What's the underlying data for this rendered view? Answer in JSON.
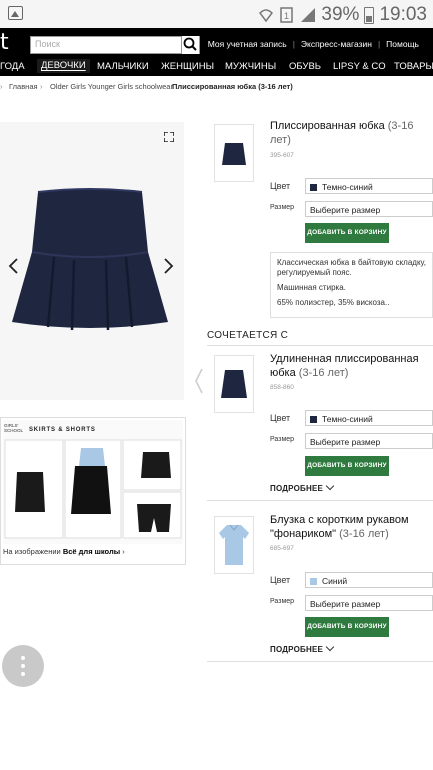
{
  "status_bar": {
    "battery": "39%",
    "time": "19:03"
  },
  "header": {
    "logo": "t",
    "search_placeholder": "Поиск",
    "links": [
      "Моя учетная запись",
      "Экспресс-магазин",
      "Помощь"
    ]
  },
  "nav": {
    "items": [
      "ГОДА",
      "ДЕВОЧКИ",
      "МАЛЬЧИКИ",
      "ЖЕНЩИНЫ",
      "МУЖЧИНЫ",
      "ОБУВЬ",
      "LIPSY & CO",
      "ТОВАРЫ ДЛ"
    ],
    "active": "ДЕВОЧКИ"
  },
  "breadcrumb": [
    "Главная",
    "Older Girls Younger Girls schoolwear",
    "Плиссированная юбка (3-16 лет)"
  ],
  "catalog": {
    "brand": "GIRLS' SCHOOL",
    "title": "SKIRTS & SHORTS",
    "caption_prefix": "На изображении",
    "caption_link": "Всё для школы"
  },
  "main_product": {
    "title": "Плиссированная юбка",
    "age": "(3-16 лет)",
    "code": "395-607",
    "color_label": "Цвет",
    "color_value": "Темно-синий",
    "size_label": "Размер",
    "size_value": "Выберите размер",
    "button": "ДОБАВИТЬ В КОРЗИНУ",
    "description": [
      "Классическая юбка в байтовую складку, регулируемый пояс.",
      "Машинная стирка.",
      "65% полиэстер, 35% вискоза.."
    ]
  },
  "section_title": "СОЧЕТАЕТСЯ С",
  "related": [
    {
      "title": "Удлиненная плиссированная юбка",
      "age": "(3-16 лет)",
      "code": "858-860",
      "color_label": "Цвет",
      "color_value": "Темно-синий",
      "size_label": "Размер",
      "size_value": "Выберите размер",
      "button": "ДОБАВИТЬ В КОРЗИНУ",
      "more": "ПОДРОБНЕЕ"
    },
    {
      "title": "Блузка с коротким рукавом \"фонариком\"",
      "age": "(3-16 лет)",
      "code": "685-697",
      "color_label": "Цвет",
      "color_value": "Синий",
      "size_label": "Размер",
      "size_value": "Выберите размер",
      "button": "ДОБАВИТЬ В КОРЗИНУ",
      "more": "ПОДРОБНЕЕ"
    }
  ],
  "colors": {
    "navy": "#1f2640",
    "light_blue": "#a9c8e6",
    "green_button": "#2f7a3f"
  }
}
